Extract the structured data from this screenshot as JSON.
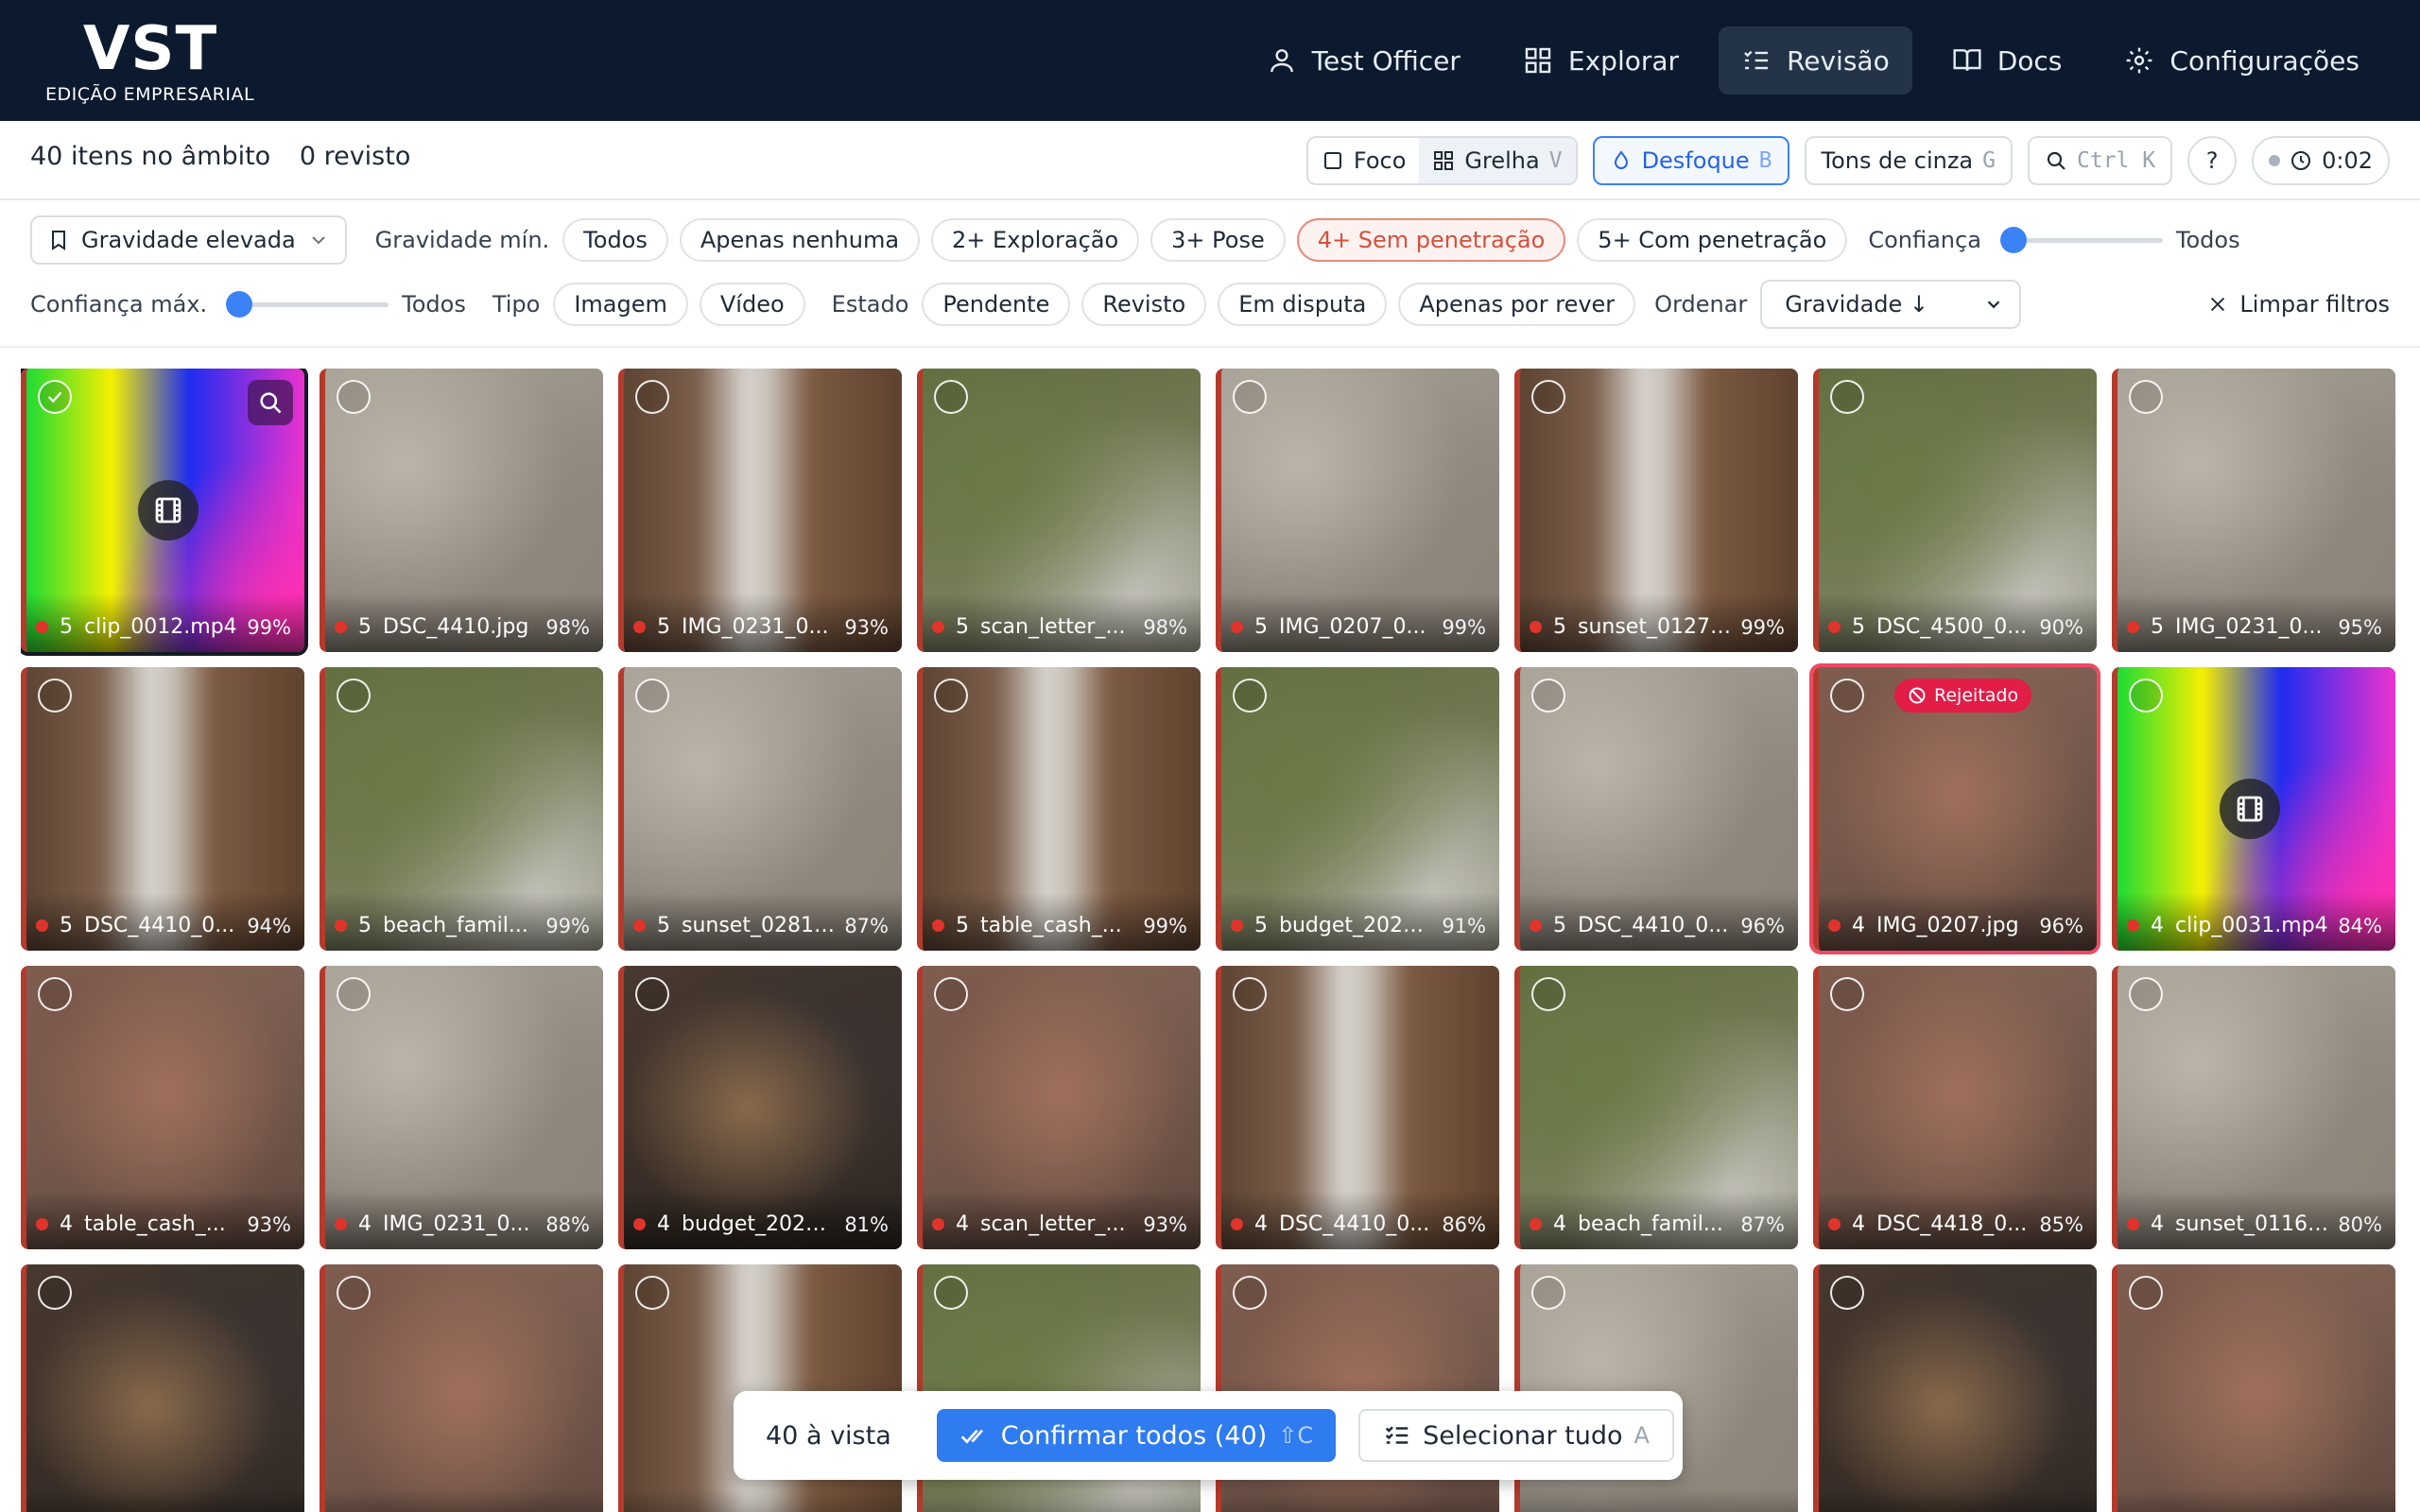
{
  "app": {
    "name": "VST",
    "edition": "EDIÇÃO EMPRESARIAL"
  },
  "nav": [
    {
      "label": "Test Officer",
      "icon": "user-icon",
      "active": false
    },
    {
      "label": "Explorar",
      "icon": "grid-icon",
      "active": false
    },
    {
      "label": "Revisão",
      "icon": "checklist-icon",
      "active": true
    },
    {
      "label": "Docs",
      "icon": "book-icon",
      "active": false
    },
    {
      "label": "Configurações",
      "icon": "gear-icon",
      "active": false
    }
  ],
  "status": {
    "scope": "40 itens no âmbito",
    "reviewed": "0 revisto"
  },
  "toolbar": {
    "focus": {
      "label": "Foco"
    },
    "grid": {
      "label": "Grelha",
      "key": "V"
    },
    "blur": {
      "label": "Desfoque",
      "key": "B"
    },
    "grayscale": {
      "label": "Tons de cinza",
      "key": "G"
    },
    "search": {
      "key": "Ctrl K"
    },
    "help": "?",
    "timer": "0:02"
  },
  "filters": {
    "preset": "Gravidade elevada",
    "min_severity_label": "Gravidade mín.",
    "severity_chips": [
      {
        "label": "Todos",
        "selected": false
      },
      {
        "label": "Apenas nenhuma",
        "selected": false
      },
      {
        "label": "2+ Exploração",
        "selected": false
      },
      {
        "label": "3+ Pose",
        "selected": false
      },
      {
        "label": "4+ Sem penetração",
        "selected": true
      },
      {
        "label": "5+ Com penetração",
        "selected": false
      }
    ],
    "confidence_label": "Confiança",
    "confidence_value": "Todos",
    "confidence_min_fraction": 0,
    "max_confidence_label": "Confiança máx.",
    "max_confidence_value": "Todos",
    "max_confidence_fraction": 0,
    "type_label": "Tipo",
    "type_chips": [
      "Imagem",
      "Vídeo"
    ],
    "state_label": "Estado",
    "state_chips": [
      "Pendente",
      "Revisto",
      "Em disputa",
      "Apenas por rever"
    ],
    "sort_label": "Ordenar",
    "sort_value": "Gravidade ↓",
    "clear": "Limpar filtros"
  },
  "items": [
    {
      "sev": "5",
      "name": "clip_0012.mp4",
      "conf": "99%",
      "palette": "rainbow",
      "video": true,
      "selected": true
    },
    {
      "sev": "5",
      "name": "DSC_4410.jpg",
      "conf": "98%",
      "palette": "grey"
    },
    {
      "sev": "5",
      "name": "IMG_0231_0...",
      "conf": "93%",
      "palette": "brownwhite"
    },
    {
      "sev": "5",
      "name": "scan_letter_...",
      "conf": "98%",
      "palette": "green"
    },
    {
      "sev": "5",
      "name": "IMG_0207_0...",
      "conf": "99%",
      "palette": "grey"
    },
    {
      "sev": "5",
      "name": "sunset_0127....",
      "conf": "99%",
      "palette": "brownwhite"
    },
    {
      "sev": "5",
      "name": "DSC_4500_0...",
      "conf": "90%",
      "palette": "green"
    },
    {
      "sev": "5",
      "name": "IMG_0231_0...",
      "conf": "95%",
      "palette": "grey"
    },
    {
      "sev": "5",
      "name": "DSC_4410_0...",
      "conf": "94%",
      "palette": "brownwhite"
    },
    {
      "sev": "5",
      "name": "beach_famil...",
      "conf": "99%",
      "palette": "green"
    },
    {
      "sev": "5",
      "name": "sunset_0281....",
      "conf": "87%",
      "palette": "grey"
    },
    {
      "sev": "5",
      "name": "table_cash_...",
      "conf": "99%",
      "palette": "brownwhite"
    },
    {
      "sev": "5",
      "name": "budget_2025...",
      "conf": "91%",
      "palette": "green"
    },
    {
      "sev": "5",
      "name": "DSC_4410_0...",
      "conf": "96%",
      "palette": "grey"
    },
    {
      "sev": "4",
      "name": "IMG_0207.jpg",
      "conf": "96%",
      "palette": "skin",
      "rejected": true,
      "badge": "Rejeitado"
    },
    {
      "sev": "4",
      "name": "clip_0031.mp4",
      "conf": "84%",
      "palette": "rainbow",
      "video": true
    },
    {
      "sev": "4",
      "name": "table_cash_...",
      "conf": "93%",
      "palette": "skin"
    },
    {
      "sev": "4",
      "name": "IMG_0231_0...",
      "conf": "88%",
      "palette": "grey"
    },
    {
      "sev": "4",
      "name": "budget_2025...",
      "conf": "81%",
      "palette": "dark"
    },
    {
      "sev": "4",
      "name": "scan_letter_...",
      "conf": "93%",
      "palette": "skin"
    },
    {
      "sev": "4",
      "name": "DSC_4410_0...",
      "conf": "86%",
      "palette": "brownwhite"
    },
    {
      "sev": "4",
      "name": "beach_famil...",
      "conf": "87%",
      "palette": "green"
    },
    {
      "sev": "4",
      "name": "DSC_4418_0...",
      "conf": "85%",
      "palette": "skin"
    },
    {
      "sev": "4",
      "name": "sunset_0116....",
      "conf": "80%",
      "palette": "grey"
    },
    {
      "sev": "",
      "name": "",
      "conf": "",
      "palette": "dark"
    },
    {
      "sev": "",
      "name": "",
      "conf": "",
      "palette": "skin"
    },
    {
      "sev": "",
      "name": "",
      "conf": "",
      "palette": "brownwhite"
    },
    {
      "sev": "",
      "name": "",
      "conf": "",
      "palette": "green"
    },
    {
      "sev": "",
      "name": "",
      "conf": "",
      "palette": "skin"
    },
    {
      "sev": "",
      "name": "",
      "conf": "",
      "palette": "grey"
    },
    {
      "sev": "",
      "name": "",
      "conf": "",
      "palette": "dark"
    },
    {
      "sev": "",
      "name": "",
      "conf": "",
      "palette": "skin"
    }
  ],
  "actionbar": {
    "in_view": "40 à vista",
    "confirm_all": "Confirmar todos (40)",
    "confirm_key": "⇧C",
    "select_all": "Selecionar tudo",
    "select_key": "A"
  },
  "colors": {
    "header_bg": "#0b1a2e",
    "accent": "#2f7bf0",
    "severity_dot": "#e0342a",
    "rejected": "#e11d48",
    "selected_chip": "#d6503d"
  }
}
